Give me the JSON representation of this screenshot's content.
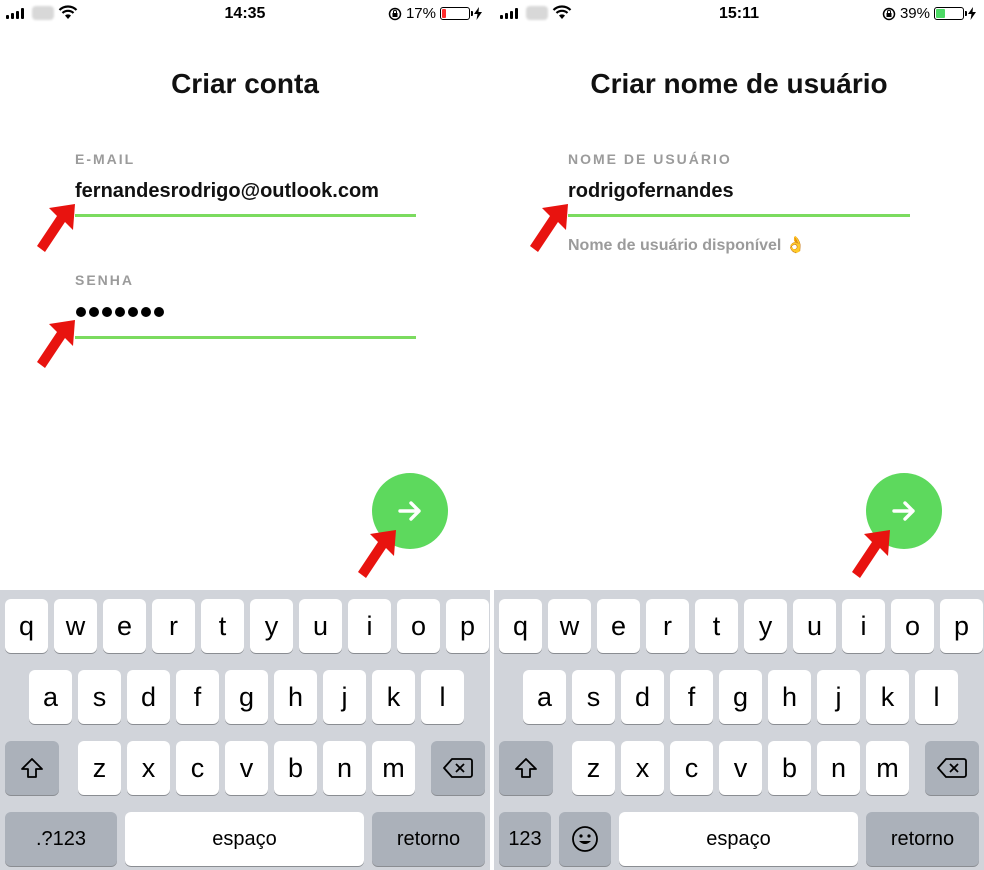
{
  "left": {
    "status": {
      "time": "14:35",
      "battery": "17%",
      "battery_level": 0.17,
      "battery_color": "#ff2d2d"
    },
    "title": "Criar conta",
    "email_label": "E-MAIL",
    "email_value": "fernandesrodrigo@outlook.com",
    "password_label": "SENHA",
    "password_length": 7,
    "keyboard": {
      "row1": [
        "q",
        "w",
        "e",
        "r",
        "t",
        "y",
        "u",
        "i",
        "o",
        "p"
      ],
      "row2": [
        "a",
        "s",
        "d",
        "f",
        "g",
        "h",
        "j",
        "k",
        "l"
      ],
      "row3": [
        "z",
        "x",
        "c",
        "v",
        "b",
        "n",
        "m"
      ],
      "numbers_key": ".?123",
      "space_key": "espaço",
      "return_key": "retorno"
    }
  },
  "right": {
    "status": {
      "time": "15:11",
      "battery": "39%",
      "battery_level": 0.39,
      "battery_color": "#4cd964"
    },
    "title": "Criar nome de usuário",
    "username_label": "NOME DE USUÁRIO",
    "username_value": "rodrigofernandes",
    "availability": "Nome de usuário disponível",
    "keyboard": {
      "row1": [
        "q",
        "w",
        "e",
        "r",
        "t",
        "y",
        "u",
        "i",
        "o",
        "p"
      ],
      "row2": [
        "a",
        "s",
        "d",
        "f",
        "g",
        "h",
        "j",
        "k",
        "l"
      ],
      "row3": [
        "z",
        "x",
        "c",
        "v",
        "b",
        "n",
        "m"
      ],
      "numbers_key": "123",
      "space_key": "espaço",
      "return_key": "retorno"
    }
  },
  "colors": {
    "accent_green": "#5dd95d",
    "underline_green": "#7bdb5f",
    "annotation_red": "#e8130f"
  },
  "icons": [
    "wifi-icon",
    "orientation-lock-icon",
    "battery-icon",
    "charging-bolt-icon",
    "arrow-right-icon",
    "shift-icon",
    "backspace-icon",
    "emoji-icon",
    "red-pointer-arrow-icon",
    "ok-hand-emoji-icon"
  ]
}
